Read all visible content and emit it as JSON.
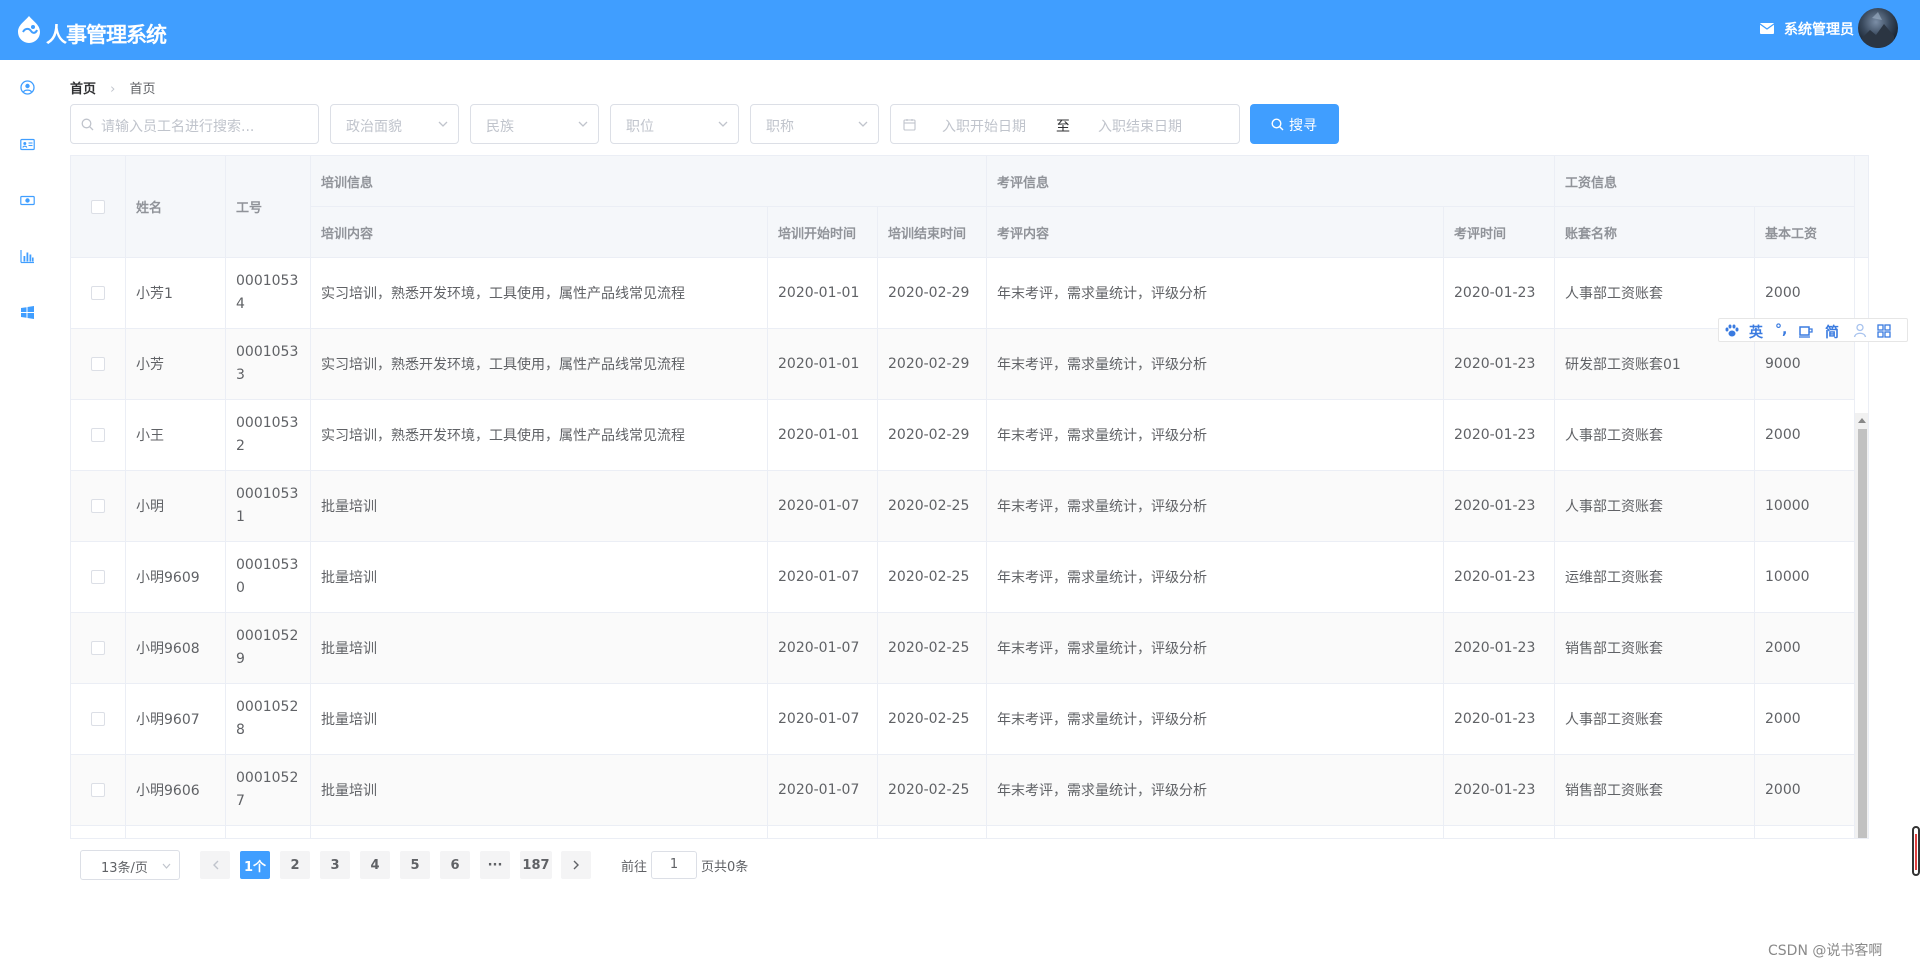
{
  "header": {
    "title": "人事管理系统",
    "user_name": "系统管理员"
  },
  "sidebar": {
    "icons": [
      "user-circle-icon",
      "id-card-icon",
      "money-icon",
      "bar-chart-icon",
      "windows-icon"
    ]
  },
  "breadcrumb": {
    "home": "首页",
    "current": "首页"
  },
  "search": {
    "name_placeholder": "请输入员工名进行搜索...",
    "politic_placeholder": "政治面貌",
    "nation_placeholder": "民族",
    "position_placeholder": "职位",
    "jobtitle_placeholder": "职称",
    "date_start_placeholder": "入职开始日期",
    "date_separator": "至",
    "date_end_placeholder": "入职结束日期",
    "button_label": "搜寻"
  },
  "table": {
    "headers": {
      "name": "姓名",
      "work_id": "工号",
      "group_train": "培训信息",
      "group_appraise": "考评信息",
      "group_salary": "工资信息",
      "train_content": "培训内容",
      "train_start": "培训开始时间",
      "train_end": "培训结束时间",
      "appraise_content": "考评内容",
      "appraise_date": "考评时间",
      "salary_name": "账套名称",
      "basic_salary": "基本工资"
    },
    "rows": [
      {
        "name": "小芳1",
        "work_id": "00010534",
        "train_content": "实习培训，熟悉开发环境，工具使用，属性产品线常见流程",
        "train_start": "2020-01-01",
        "train_end": "2020-02-29",
        "appraise_content": "年末考评，需求量统计，评级分析",
        "appraise_date": "2020-01-23",
        "salary_name": "人事部工资账套",
        "basic_salary": "2000"
      },
      {
        "name": "小芳",
        "work_id": "00010533",
        "train_content": "实习培训，熟悉开发环境，工具使用，属性产品线常见流程",
        "train_start": "2020-01-01",
        "train_end": "2020-02-29",
        "appraise_content": "年末考评，需求量统计，评级分析",
        "appraise_date": "2020-01-23",
        "salary_name": "研发部工资账套01",
        "basic_salary": "9000"
      },
      {
        "name": "小王",
        "work_id": "00010532",
        "train_content": "实习培训，熟悉开发环境，工具使用，属性产品线常见流程",
        "train_start": "2020-01-01",
        "train_end": "2020-02-29",
        "appraise_content": "年末考评，需求量统计，评级分析",
        "appraise_date": "2020-01-23",
        "salary_name": "人事部工资账套",
        "basic_salary": "2000"
      },
      {
        "name": "小明",
        "work_id": "00010531",
        "train_content": "批量培训",
        "train_start": "2020-01-07",
        "train_end": "2020-02-25",
        "appraise_content": "年末考评，需求量统计，评级分析",
        "appraise_date": "2020-01-23",
        "salary_name": "人事部工资账套",
        "basic_salary": "10000"
      },
      {
        "name": "小明9609",
        "work_id": "00010530",
        "train_content": "批量培训",
        "train_start": "2020-01-07",
        "train_end": "2020-02-25",
        "appraise_content": "年末考评，需求量统计，评级分析",
        "appraise_date": "2020-01-23",
        "salary_name": "运维部工资账套",
        "basic_salary": "10000"
      },
      {
        "name": "小明9608",
        "work_id": "00010529",
        "train_content": "批量培训",
        "train_start": "2020-01-07",
        "train_end": "2020-02-25",
        "appraise_content": "年末考评，需求量统计，评级分析",
        "appraise_date": "2020-01-23",
        "salary_name": "销售部工资账套",
        "basic_salary": "2000"
      },
      {
        "name": "小明9607",
        "work_id": "00010528",
        "train_content": "批量培训",
        "train_start": "2020-01-07",
        "train_end": "2020-02-25",
        "appraise_content": "年末考评，需求量统计，评级分析",
        "appraise_date": "2020-01-23",
        "salary_name": "人事部工资账套",
        "basic_salary": "2000"
      },
      {
        "name": "小明9606",
        "work_id": "00010527",
        "train_content": "批量培训",
        "train_start": "2020-01-07",
        "train_end": "2020-02-25",
        "appraise_content": "年末考评，需求量统计，评级分析",
        "appraise_date": "2020-01-23",
        "salary_name": "销售部工资账套",
        "basic_salary": "2000"
      }
    ]
  },
  "pagination": {
    "page_size": "13条/页",
    "pages": [
      "1个",
      "2",
      "3",
      "4",
      "5",
      "6",
      "···",
      "187"
    ],
    "goto_label": "前往",
    "goto_value": "1",
    "total_label": "页共0条"
  },
  "ime_toolbar": {
    "lang": "英",
    "punct": "°,",
    "simplified": "简"
  },
  "watermark": "CSDN @说书客啊",
  "colors": {
    "primary": "#409eff",
    "header_bg": "#f5f7fa",
    "border": "#ebeef5",
    "text": "#606266",
    "placeholder": "#c0c4cc"
  }
}
